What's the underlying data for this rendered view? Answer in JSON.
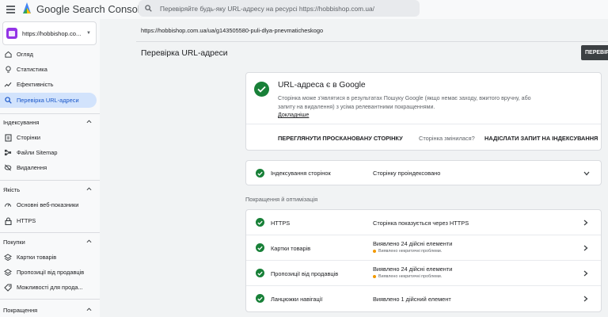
{
  "app": {
    "title": "Google Search Console",
    "search_placeholder": "Перевіряйте будь-яку URL-адресу на ресурсі https://hobbishop.com.ua/"
  },
  "property": {
    "label": "https://hobbishop.co..."
  },
  "sidebar": {
    "items": [
      {
        "label": "Огляд",
        "icon": "home-icon"
      },
      {
        "label": "Статистика",
        "icon": "lightbulb-icon"
      },
      {
        "label": "Ефективність",
        "icon": "trending-up-icon"
      },
      {
        "label": "Перевірка URL-адреси",
        "icon": "search-icon",
        "active": true
      }
    ],
    "sections": [
      {
        "title": "Індексування",
        "items": [
          {
            "label": "Сторінки",
            "icon": "pages-icon"
          },
          {
            "label": "Файли Sitemap",
            "icon": "sitemap-icon"
          },
          {
            "label": "Видалення",
            "icon": "removals-icon"
          }
        ]
      },
      {
        "title": "Якість",
        "items": [
          {
            "label": "Основні веб-показники",
            "icon": "gauge-icon"
          },
          {
            "label": "HTTPS",
            "icon": "lock-icon"
          }
        ]
      },
      {
        "title": "Покупки",
        "items": [
          {
            "label": "Картки товарів",
            "icon": "product-icon"
          },
          {
            "label": "Пропозиції від продавців",
            "icon": "merchant-icon"
          },
          {
            "label": "Можливості для прода...",
            "icon": "tag-icon"
          }
        ]
      },
      {
        "title": "Покращення",
        "items": []
      }
    ]
  },
  "main": {
    "inspected_url": "https://hobbishop.com.ua/ua/g143505580-puli-dlya-pnevmaticheskogo",
    "page_title": "Перевірка URL-адреси",
    "check_button": "ПЕРЕВІР",
    "status": {
      "title": "URL-адреса є в Google",
      "description": "Сторінка може з'являтися в результатах Пошуку Google (якщо немає заходу, вжитого вручну, або запиту на видалення) з усіма релевантними покращеннями.",
      "learn_more": "Докладніше",
      "view_crawled": "ПЕРЕГЛЯНУТИ ПРОСКАНОВАНУ СТОРІНКУ",
      "page_changed_q": "Сторінка змінилася?",
      "request_indexing": "НАДІСЛАТИ ЗАПИТ НА ІНДЕКСУВАННЯ"
    },
    "indexing": {
      "label": "Індексування сторінок",
      "value": "Сторінку проіндексовано"
    },
    "enhancements_heading": "Покращення й оптимізація",
    "enhancements": [
      {
        "label": "HTTPS",
        "value": "Сторінка показується через HTTPS",
        "sub": ""
      },
      {
        "label": "Картки товарів",
        "value": "Виявлено 24 дійсні елементи",
        "sub": "Виявлено некритичні проблеми."
      },
      {
        "label": "Пропозиції від продавців",
        "value": "Виявлено 24 дійсні елементи",
        "sub": "Виявлено некритичні проблеми."
      },
      {
        "label": "Ланцюжки навігації",
        "value": "Виявлено 1 дійсний елемент",
        "sub": ""
      }
    ]
  }
}
